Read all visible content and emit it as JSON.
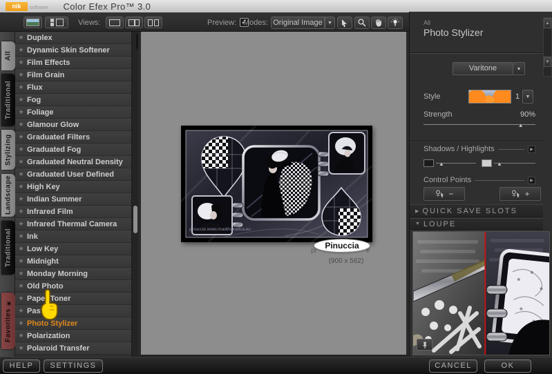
{
  "title_bar": {
    "brand": "nik",
    "brand_sub": "software",
    "title": "Color Efex Pro™ 3.0"
  },
  "toolbar": {
    "views_label": "Views:",
    "preview_label": "Preview:",
    "modes_label": "Modes:",
    "modes_value": "Original Image"
  },
  "sidebar": {
    "tabs": [
      {
        "label": "All",
        "variant": "light"
      },
      {
        "label": "Traditional",
        "variant": "dark"
      },
      {
        "label": "Stylizing",
        "variant": "light"
      },
      {
        "label": "Landscape",
        "variant": "light"
      },
      {
        "label": "Traditional",
        "variant": "dark"
      },
      {
        "label": "Favorites",
        "variant": "favorites"
      }
    ],
    "filters": [
      {
        "label": "Duplex",
        "selected": false
      },
      {
        "label": "Dynamic Skin Softener",
        "selected": false
      },
      {
        "label": "Film Effects",
        "selected": false
      },
      {
        "label": "Film Grain",
        "selected": false
      },
      {
        "label": "Flux",
        "selected": false
      },
      {
        "label": "Fog",
        "selected": false
      },
      {
        "label": "Foliage",
        "selected": false
      },
      {
        "label": "Glamour Glow",
        "selected": false
      },
      {
        "label": "Graduated Filters",
        "selected": false
      },
      {
        "label": "Graduated Fog",
        "selected": false
      },
      {
        "label": "Graduated Neutral Density",
        "selected": false
      },
      {
        "label": "Graduated User Defined",
        "selected": false
      },
      {
        "label": "High Key",
        "selected": false
      },
      {
        "label": "Indian Summer",
        "selected": false
      },
      {
        "label": "Infrared Film",
        "selected": false
      },
      {
        "label": "Infrared Thermal Camera",
        "selected": false
      },
      {
        "label": "Ink",
        "selected": false
      },
      {
        "label": "Low Key",
        "selected": false
      },
      {
        "label": "Midnight",
        "selected": false
      },
      {
        "label": "Monday Morning",
        "selected": false
      },
      {
        "label": "Old Photo",
        "selected": false
      },
      {
        "label": "Paper Toner",
        "selected": false
      },
      {
        "label": "Pastel",
        "selected": false
      },
      {
        "label": "Photo Stylizer",
        "selected": true
      },
      {
        "label": "Polarization",
        "selected": false
      },
      {
        "label": "Polaroid Transfer",
        "selected": false
      }
    ]
  },
  "preview": {
    "badge": "Pinuccia",
    "caption_left": "pi",
    "caption_right": "e",
    "size_text": "(900 x 562)",
    "watermark": "pinuccia www.madlingrafica.eu"
  },
  "panel": {
    "category": "All",
    "filter_name": "Photo Stylizer",
    "method_value": "Varitone",
    "style_label": "Style",
    "style_value": "1",
    "strength_label": "Strength",
    "strength_value": "90%",
    "strength_percent": 90,
    "shadows_highlights_label": "Shadows / Highlights",
    "control_points_label": "Control Points",
    "cp_minus": "−",
    "cp_plus": "+",
    "quick_save_label": "QUICK SAVE SLOTS",
    "loupe_label": "LOUPE"
  },
  "footer": {
    "help": "HELP",
    "settings": "SETTINGS",
    "cancel": "CANCEL",
    "ok": "OK"
  }
}
